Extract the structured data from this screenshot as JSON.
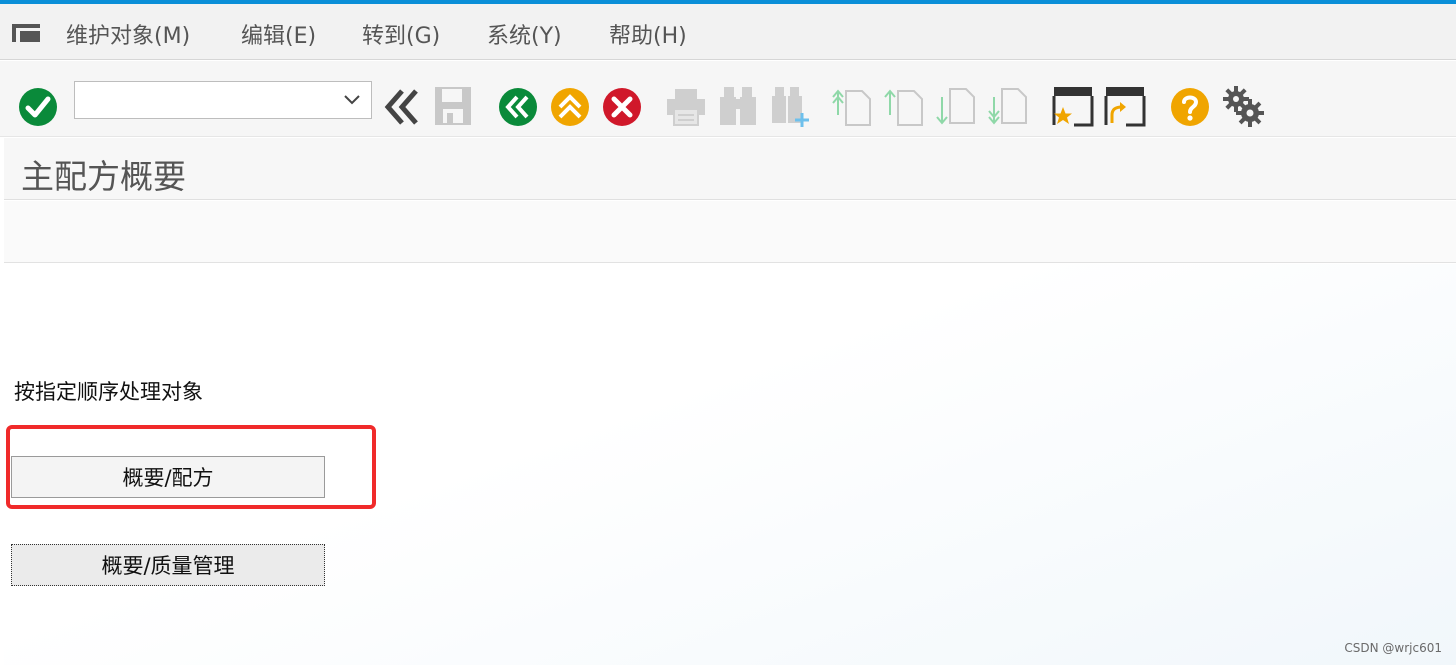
{
  "menubar": {
    "items": [
      {
        "label": "维护对象(M)"
      },
      {
        "label": "编辑(E)"
      },
      {
        "label": "转到(G)"
      },
      {
        "label": "系统(Y)"
      },
      {
        "label": "帮助(H)"
      }
    ]
  },
  "toolbar": {
    "command_field_value": "",
    "icons": [
      "enter-icon",
      "command-field",
      "collapse-icon",
      "save-icon",
      "back-icon",
      "exit-icon",
      "cancel-icon",
      "print-icon",
      "find-icon",
      "find-next-icon",
      "first-page-icon",
      "previous-page-icon",
      "next-page-icon",
      "last-page-icon",
      "create-session-icon",
      "shortcut-icon",
      "help-icon",
      "settings-icon"
    ]
  },
  "title": "主配方概要",
  "content": {
    "instruction": "按指定顺序处理对象",
    "buttons": [
      {
        "label": "概要/配方"
      },
      {
        "label": "概要/质量管理"
      }
    ]
  },
  "watermark": "CSDN @wrjc601",
  "colors": {
    "accent_strip": "#0a8fd8",
    "green": "#0a8a3a",
    "orange": "#f0a500",
    "red": "#d0182a",
    "highlight_red": "#f02a2a"
  }
}
